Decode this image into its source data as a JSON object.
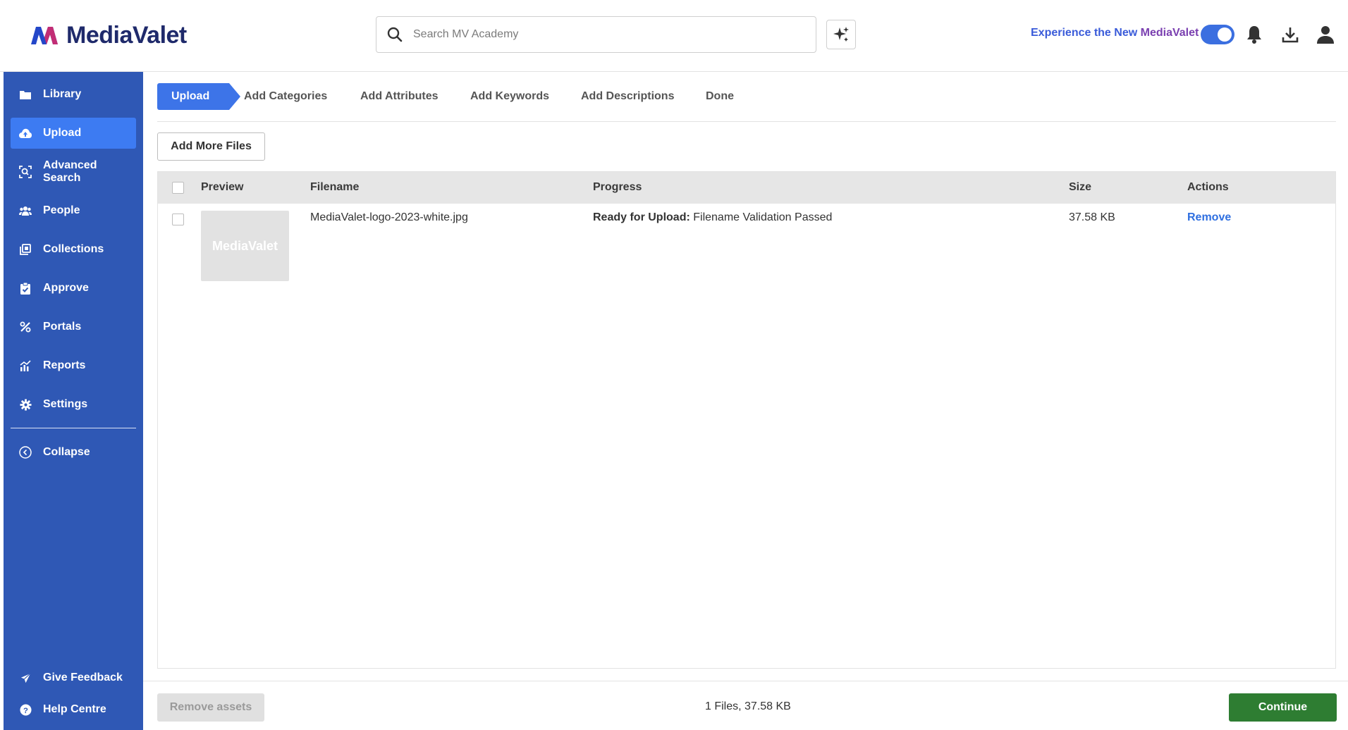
{
  "app": {
    "logo_text": "MediaValet",
    "brand_colors": {
      "logo_dark": "#1f2a6b",
      "sidebar": "#2f58b5",
      "active": "#3d7bf2",
      "continue": "#2e7d32"
    }
  },
  "header": {
    "search_placeholder": "Search MV Academy",
    "experience_label_part1": "Experience the New ",
    "experience_label_part2": "MediaValet",
    "toggle_on": true,
    "icons": [
      "search-icon",
      "sparkle-icon",
      "bell-icon",
      "download-icon",
      "user-icon"
    ]
  },
  "sidebar": {
    "items": [
      {
        "label": "Library",
        "icon": "folder-icon",
        "active": false
      },
      {
        "label": "Upload",
        "icon": "cloud-upload-icon",
        "active": true
      },
      {
        "label": "Advanced Search",
        "icon": "advanced-search-icon",
        "active": false
      },
      {
        "label": "People",
        "icon": "people-icon",
        "active": false
      },
      {
        "label": "Collections",
        "icon": "collections-icon",
        "active": false
      },
      {
        "label": "Approve",
        "icon": "clipboard-check-icon",
        "active": false
      },
      {
        "label": "Portals",
        "icon": "portals-icon",
        "active": false
      },
      {
        "label": "Reports",
        "icon": "chart-icon",
        "active": false
      },
      {
        "label": "Settings",
        "icon": "gear-icon",
        "active": false
      }
    ],
    "collapse_label": "Collapse",
    "feedback_label": "Give Feedback",
    "help_label": "Help Centre"
  },
  "steps": {
    "items": [
      "Upload",
      "Add Categories",
      "Add Attributes",
      "Add Keywords",
      "Add Descriptions",
      "Done"
    ],
    "active_index": 0
  },
  "toolbar": {
    "add_more_label": "Add More Files"
  },
  "table": {
    "headers": {
      "preview": "Preview",
      "filename": "Filename",
      "progress": "Progress",
      "size": "Size",
      "actions": "Actions"
    },
    "rows": [
      {
        "thumb_text": "MediaValet",
        "filename": "MediaValet-logo-2023-white.jpg",
        "progress_status": "Ready for Upload:",
        "progress_detail": " Filename Validation Passed",
        "size": "37.58 KB",
        "action": "Remove"
      }
    ]
  },
  "footer": {
    "remove_assets_label": "Remove assets",
    "summary": "1 Files, 37.58 KB",
    "continue_label": "Continue"
  }
}
